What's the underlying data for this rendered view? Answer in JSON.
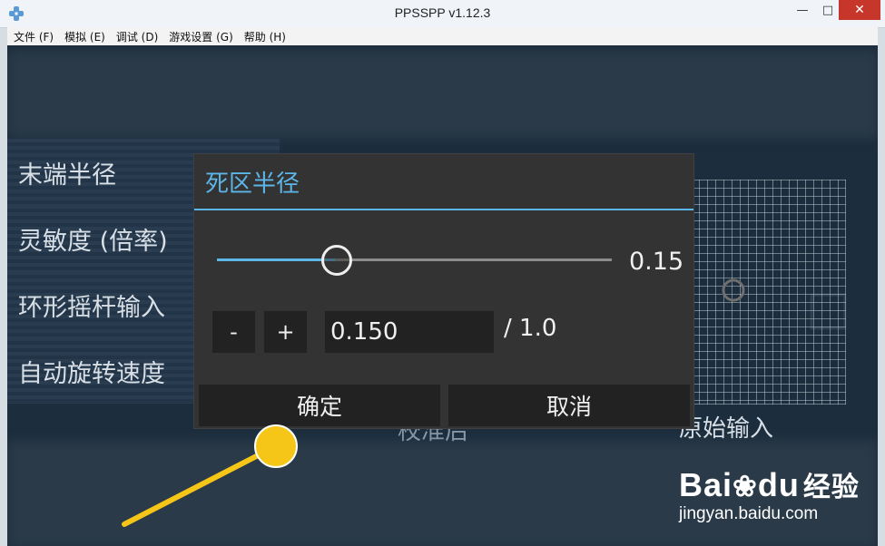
{
  "window": {
    "title": "PPSSPP v1.12.3",
    "controls": {
      "minimize": "—",
      "maximize": "□",
      "close": "✕"
    }
  },
  "menu": [
    {
      "label": "文件 (F)"
    },
    {
      "label": "模拟 (E)"
    },
    {
      "label": "调试 (D)"
    },
    {
      "label": "游戏设置 (G)"
    },
    {
      "label": "帮助 (H)"
    }
  ],
  "settings_list": [
    {
      "label": "末端半径"
    },
    {
      "label": "灵敏度 (倍率)"
    },
    {
      "label": "环形摇杆输入"
    },
    {
      "label": "自动旋转速度"
    }
  ],
  "background": {
    "mid_label": "校准后",
    "preview_label": "原始输入"
  },
  "dialog": {
    "title": "死区半径",
    "slider": {
      "value": 0.15,
      "min": 0,
      "max": 1.0,
      "value_text": "0.15"
    },
    "stepper": {
      "minus": "-",
      "plus": "+"
    },
    "input_value": "0.150",
    "max_label": "/ 1.0",
    "ok_label": "确定",
    "cancel_label": "取消"
  },
  "watermark": {
    "brand": "Bai",
    "brand_suffix": "经验",
    "url": "jingyan.baidu.com"
  },
  "colors": {
    "accent": "#5cb6e8",
    "dialog_bg": "#333333",
    "button_bg": "#222222",
    "annotation": "#f5c518"
  }
}
